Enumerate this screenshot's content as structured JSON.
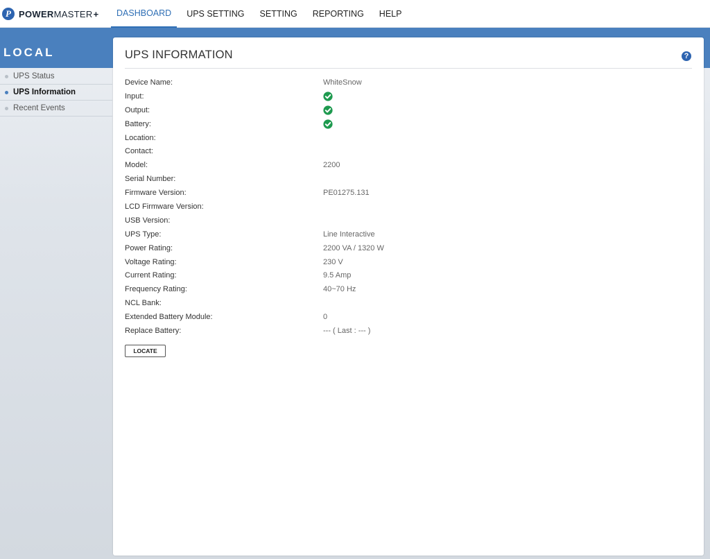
{
  "brand": {
    "prefix": "POWER",
    "suffix": "MASTER",
    "plus": "+",
    "badge": "P"
  },
  "nav": [
    {
      "label": "DASHBOARD",
      "active": true
    },
    {
      "label": "UPS SETTING"
    },
    {
      "label": "SETTING"
    },
    {
      "label": "REPORTING"
    },
    {
      "label": "HELP"
    }
  ],
  "section_title": "LOCAL",
  "sidebar": {
    "items": [
      {
        "label": "UPS Status"
      },
      {
        "label": "UPS Information",
        "active": true
      },
      {
        "label": "Recent Events"
      }
    ]
  },
  "panel": {
    "title": "UPS INFORMATION",
    "help_icon": "?",
    "rows": [
      {
        "label": "Device Name:",
        "value": "WhiteSnow"
      },
      {
        "label": "Input:",
        "status": "ok"
      },
      {
        "label": "Output:",
        "status": "ok"
      },
      {
        "label": "Battery:",
        "status": "ok"
      },
      {
        "label": "Location:",
        "value": ""
      },
      {
        "label": "Contact:",
        "value": ""
      },
      {
        "label": "Model:",
        "value": "2200"
      },
      {
        "label": "Serial Number:",
        "value": ""
      },
      {
        "label": "Firmware Version:",
        "value": "PE01275.131"
      },
      {
        "label": "LCD Firmware Version:",
        "value": ""
      },
      {
        "label": "USB Version:",
        "value": ""
      },
      {
        "label": "UPS Type:",
        "value": "Line Interactive"
      },
      {
        "label": "Power Rating:",
        "value": "2200 VA / 1320 W"
      },
      {
        "label": "Voltage Rating:",
        "value": "230 V"
      },
      {
        "label": "Current Rating:",
        "value": "9.5 Amp"
      },
      {
        "label": "Frequency Rating:",
        "value": "40~70 Hz"
      },
      {
        "label": "NCL Bank:",
        "value": ""
      },
      {
        "label": "Extended Battery Module:",
        "value": "0"
      },
      {
        "label": "Replace Battery:",
        "value": "--- ( Last : --- )"
      }
    ],
    "locate_button": "LOCATE"
  },
  "colors": {
    "accent": "#2f6fb5",
    "band": "#4a80be",
    "ok": "#1e9a4f"
  },
  "icons": {
    "ok": "check-circle-icon",
    "help": "help-icon",
    "logo": "logo-icon"
  }
}
